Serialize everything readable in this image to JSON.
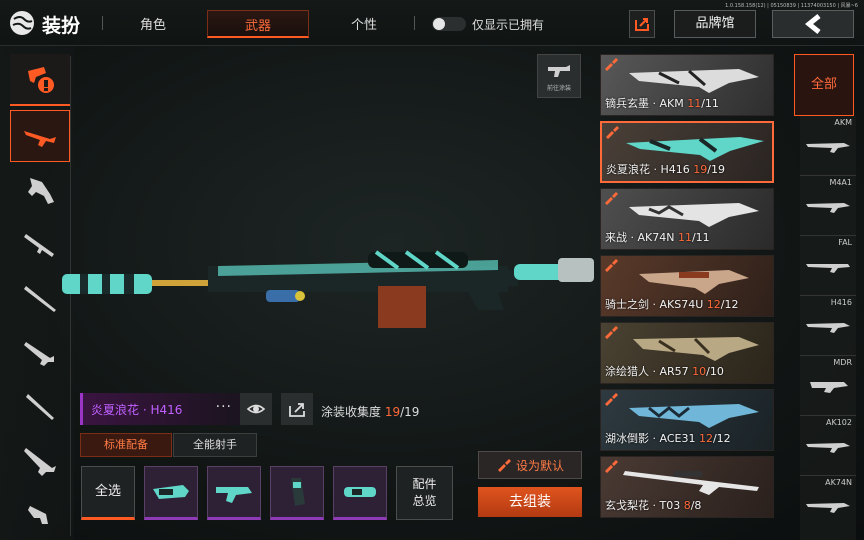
{
  "header": {
    "title": "装扮",
    "tabs": [
      {
        "label": "角色",
        "active": false
      },
      {
        "label": "武器",
        "active": true
      },
      {
        "label": "个性",
        "active": false
      }
    ],
    "owned_toggle_label": "仅显示已拥有",
    "owned_toggle_on": false,
    "brand_button": "品牌馆",
    "version": "1.0.158.158(12) | 05150839 | 11374003150 | 风暴~6"
  },
  "left_nav": {
    "items": [
      "filter-icon",
      "rifle-icon",
      "smg-icon",
      "sniper-icon",
      "shotgun-icon",
      "ar-icon",
      "marksman-icon",
      "lmg-icon",
      "pistol-icon"
    ],
    "active_index": 1
  },
  "goto_paint_label": "前往涂装",
  "selected_skin": {
    "name": "炎夏浪花 · H416",
    "dots": "···",
    "collect_label": "涂装收集度",
    "collect_have": "19",
    "collect_total": "/19"
  },
  "loadout_tabs": [
    "标准配备",
    "全能射手"
  ],
  "attachments": {
    "select_all": "全选",
    "overview_line1": "配件",
    "overview_line2": "总览"
  },
  "actions": {
    "set_default": "设为默认",
    "assemble": "去组装"
  },
  "skins": [
    {
      "name": "镝兵玄墨 · AKM ",
      "have": "11",
      "total": "/11",
      "selected": false
    },
    {
      "name": "炎夏浪花 · H416 ",
      "have": "19",
      "total": "/19",
      "selected": true
    },
    {
      "name": "来战 · AK74N ",
      "have": "11",
      "total": "/11",
      "selected": false
    },
    {
      "name": "骑士之剑 · AKS74U ",
      "have": "12",
      "total": "/12",
      "selected": false
    },
    {
      "name": "涂绘猎人 · AR57 ",
      "have": "10",
      "total": "/10",
      "selected": false
    },
    {
      "name": "湖冰倒影 · ACE31 ",
      "have": "12",
      "total": "/12",
      "selected": false
    },
    {
      "name": "玄戈梨花 · T03 ",
      "have": "8",
      "total": "/8",
      "selected": false
    }
  ],
  "gun_filter": {
    "all_label": "全部",
    "guns": [
      "AKM",
      "M4A1",
      "FAL",
      "H416",
      "MDR",
      "AK102",
      "AK74N"
    ]
  },
  "colors": {
    "accent": "#ff5a24",
    "purple": "#9b35c8",
    "teal": "#5fd6c8"
  }
}
